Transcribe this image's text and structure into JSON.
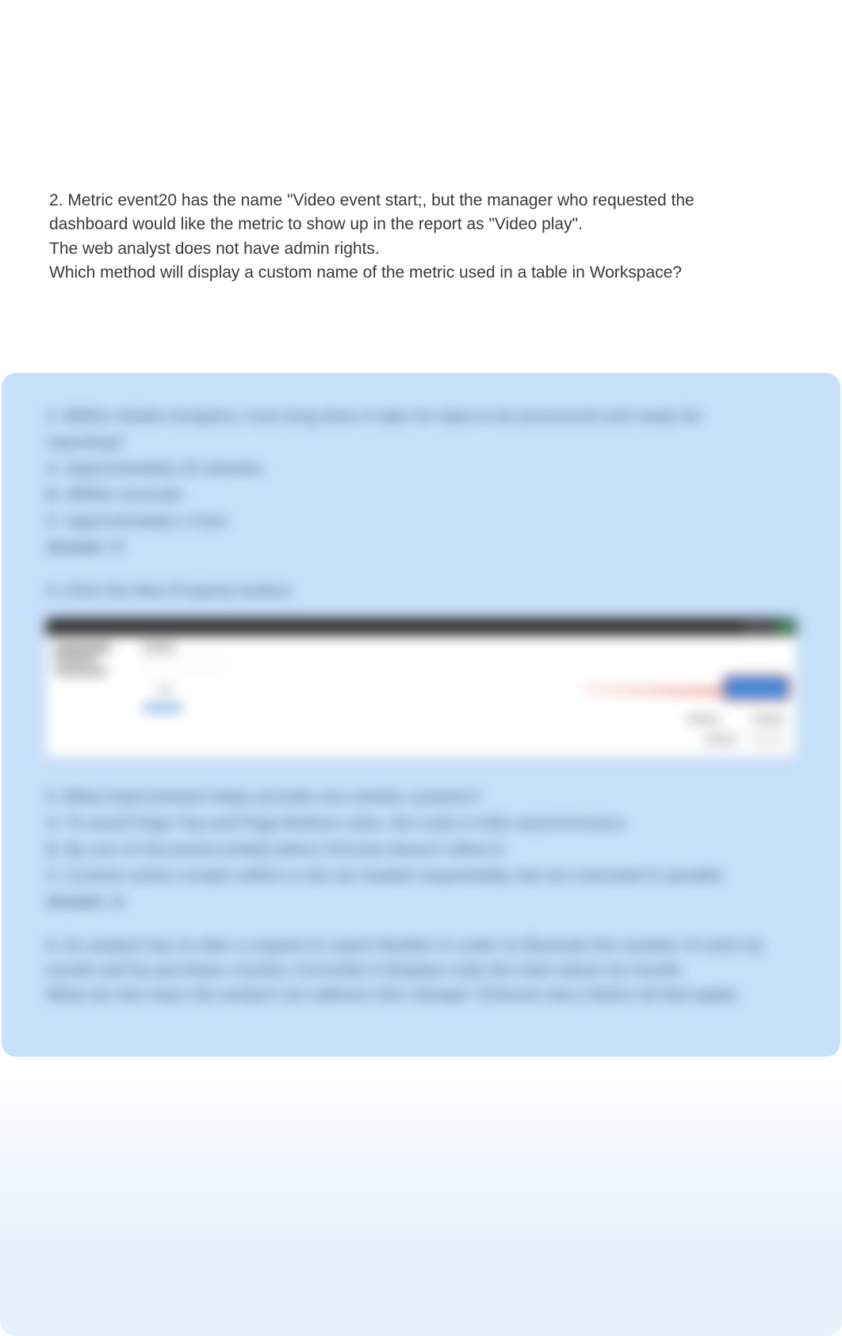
{
  "question": {
    "number_and_line1": "2. Metric event20 has the name \"Video event start;, but the manager who requested the",
    "line2": "dashboard would like the metric to show up in the report as \"Video play\".",
    "line3": "The web analyst does not have admin rights.",
    "line4": "Which method will display a custom name of the metric used in a table in Workspace?"
  },
  "blurred": {
    "q3_line1": "3. Within Adobe Analytics, how long does it take for data to be processed and ready for",
    "q3_line2": "reporting?",
    "q3_optA": "A. Approximately 15 minutes",
    "q3_optB": "B. Within seconds",
    "q3_optC": "C. Approximately 1 hour",
    "q3_answer": "Answer: C",
    "q4_line1": "4. Click the New Property button.",
    "q5_line1": "5. What improvement helps provide non-similar systems?",
    "q5_optA": "A. To avoid Page Top and Page Bottom rules, the code is fully asynchronous.",
    "q5_optB": "B. By use of document.write() where Chrome doesn't allow it.",
    "q5_optC": "C. Custom action scripts within a rule are loaded sequentially, but are executed in parallel.",
    "q5_answer": "Answer: A",
    "q6_line1": "6. An analyst has to alter a request in report Builder in order to illustrate the number of units by",
    "q6_line2": "month and by purchase country. Currently it displays only the total values by month.",
    "q6_line3": "What are two ways the analyst can address this change? (Choose two.) Select all that apply."
  }
}
